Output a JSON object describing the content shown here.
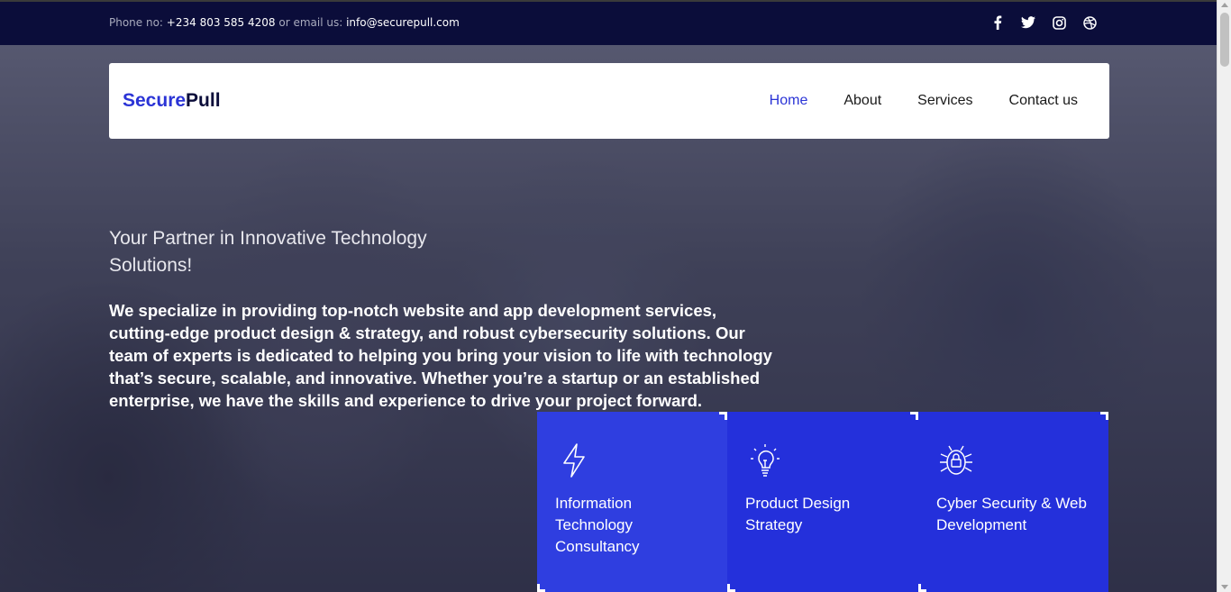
{
  "topbar": {
    "phone_label": "Phone no: ",
    "phone": "+234 803 585 4208",
    "email_label": " or email us: ",
    "email": "info@securepull.com",
    "social": [
      "facebook-icon",
      "twitter-icon",
      "instagram-icon",
      "dribbble-icon"
    ]
  },
  "brand": {
    "part1": "Secure",
    "part2": "Pull",
    "accent": "#2b34d6",
    "dark": "#0b0d3a"
  },
  "nav": {
    "items": [
      {
        "label": "Home",
        "active": true
      },
      {
        "label": "About"
      },
      {
        "label": "Services"
      },
      {
        "label": "Contact us"
      }
    ]
  },
  "hero": {
    "tagline": "Your Partner in Innovative Technology Solutions!",
    "description": "We specialize in providing top-notch website and app development services, cutting-edge product design & strategy, and robust cybersecurity solutions. Our team of experts is dedicated to helping you bring your vision to life with technology that’s secure, scalable, and innovative. Whether you’re a startup or an established enterprise, we have the skills and experience to drive your project forward."
  },
  "services": [
    {
      "icon": "lightning-icon",
      "title": "Information Technology Consultancy"
    },
    {
      "icon": "lightbulb-icon",
      "title": "Product Design Strategy"
    },
    {
      "icon": "security-bug-icon",
      "title": "Cyber Security & Web Development"
    }
  ]
}
